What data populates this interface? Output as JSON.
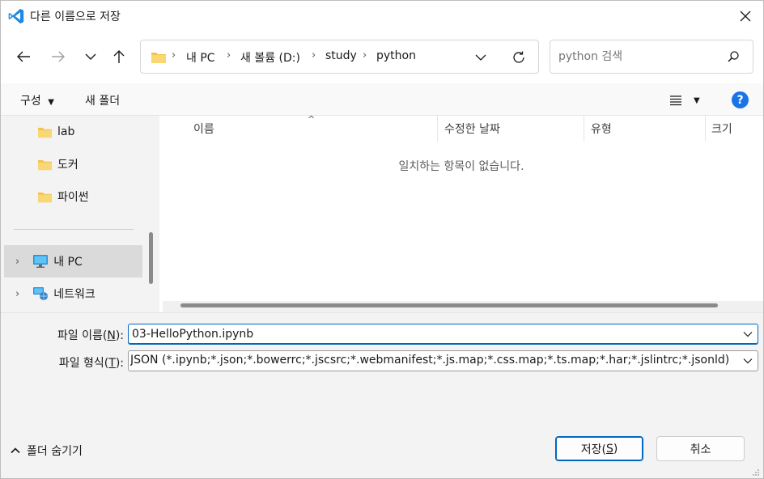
{
  "window": {
    "title": "다른 이름으로 저장",
    "accent_color": "#0067c0"
  },
  "nav": {
    "breadcrumbs": [
      "내 PC",
      "새 볼륨 (D:)",
      "study",
      "python"
    ],
    "search_placeholder": "python 검색"
  },
  "toolbar": {
    "organize_label": "구성",
    "new_folder_label": "새 폴더",
    "help_label": "?"
  },
  "sidebar": {
    "items": [
      {
        "label": "lab",
        "icon": "folder-icon"
      },
      {
        "label": "도커",
        "icon": "folder-icon"
      },
      {
        "label": "파이썬",
        "icon": "folder-icon"
      },
      {
        "label": "내 PC",
        "icon": "computer-icon"
      },
      {
        "label": "네트워크",
        "icon": "network-icon"
      }
    ]
  },
  "file_list": {
    "columns": [
      "이름",
      "수정한 날짜",
      "유형",
      "크기"
    ],
    "empty_message": "일치하는 항목이 없습니다."
  },
  "form": {
    "filename_label": "파일 이름(",
    "filename_key": "N",
    "filename_label_end": "):",
    "filename_value": "03-HelloPython.ipynb",
    "filetype_label": "파일 형식(",
    "filetype_key": "T",
    "filetype_label_end": "):",
    "filetype_value": "JSON (*.ipynb;*.json;*.bowerrc;*.jscsrc;*.webmanifest;*.js.map;*.css.map;*.ts.map;*.har;*.jslintrc;*.jsonld)"
  },
  "footer": {
    "hide_folders_label": "폴더 숨기기",
    "save_label": "저장(",
    "save_key": "S",
    "save_label_end": ")",
    "cancel_label": "취소"
  }
}
